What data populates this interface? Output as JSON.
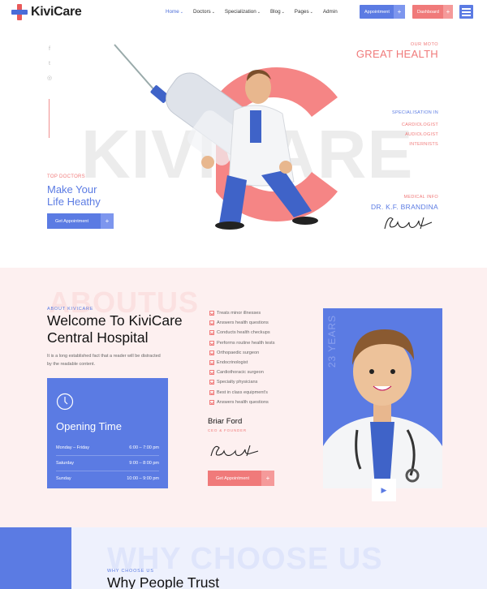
{
  "logo": {
    "text": "KiviCare"
  },
  "nav": {
    "items": [
      {
        "label": "Home",
        "dropdown": true,
        "active": true
      },
      {
        "label": "Doctors",
        "dropdown": true
      },
      {
        "label": "Specialization",
        "dropdown": true
      },
      {
        "label": "Blog",
        "dropdown": true
      },
      {
        "label": "Pages",
        "dropdown": true
      },
      {
        "label": "Admin",
        "dropdown": false
      }
    ],
    "appointment_label": "Appointment",
    "dashboard_label": "Dashboard",
    "plus": "+",
    "caret": "⌄"
  },
  "colors": {
    "accent_blue": "#5b7be3",
    "accent_pink": "#f07a7a",
    "about_bg": "#fdf0f0",
    "why_bg": "#eef1fd"
  },
  "hero": {
    "social_icons": [
      "facebook-icon",
      "twitter-icon",
      "instagram-icon"
    ],
    "social_glyphs": [
      "f",
      "t",
      "◎"
    ],
    "bg_word": "KIVICARE",
    "moto_label": "OUR MOTO",
    "moto_title": "GREAT HEALTH",
    "spec_label": "SPECIALISATION IN",
    "spec_items": [
      "CARDIOLOGIST",
      "AUDIOLOGIST",
      "INTERNISTS"
    ],
    "top_label": "TOP DOCTORS",
    "headline_line1": "Make Your",
    "headline_line2": "Life Heathy",
    "cta_label": "Get Appointment",
    "med_label": "MEDICAL INFO",
    "doctor_name": "DR. K.F. BRANDINA"
  },
  "about": {
    "bg_word": "ABOUTUS",
    "label": "ABOUT KIVICARE",
    "title_line1": "Welcome To KiviCare",
    "title_line2": "Central Hospital",
    "text": "It is a long established fact that a reader will be distracted by the readable content.",
    "opening": {
      "title": "Opening Time",
      "rows": [
        {
          "day": "Monday – Friday",
          "time": "6:00 – 7:00 pm"
        },
        {
          "day": "Saturday",
          "time": "9:00 – 8:00 pm"
        },
        {
          "day": "Sunday",
          "time": "10:00 – 9:00 pm"
        }
      ]
    },
    "services": [
      "Treats minor illnesses",
      "Answers health questions",
      "Conducts health checkups",
      "Performs routine health tests",
      "Orthopaedic surgeon",
      "Endocrinologist",
      "Cardiothoracic surgeon",
      "Specialty physicians",
      "Best in class equipment's",
      "Answers health questions"
    ],
    "ceo_name": "Briar Ford",
    "ceo_role": "CEO & FOUNDER",
    "cta_label": "Get Appointment",
    "years": "23 YEARS"
  },
  "why": {
    "bg_word": "WHY CHOOSE US",
    "label": "WHY CHOOSE US",
    "title": "Why People Trust"
  }
}
